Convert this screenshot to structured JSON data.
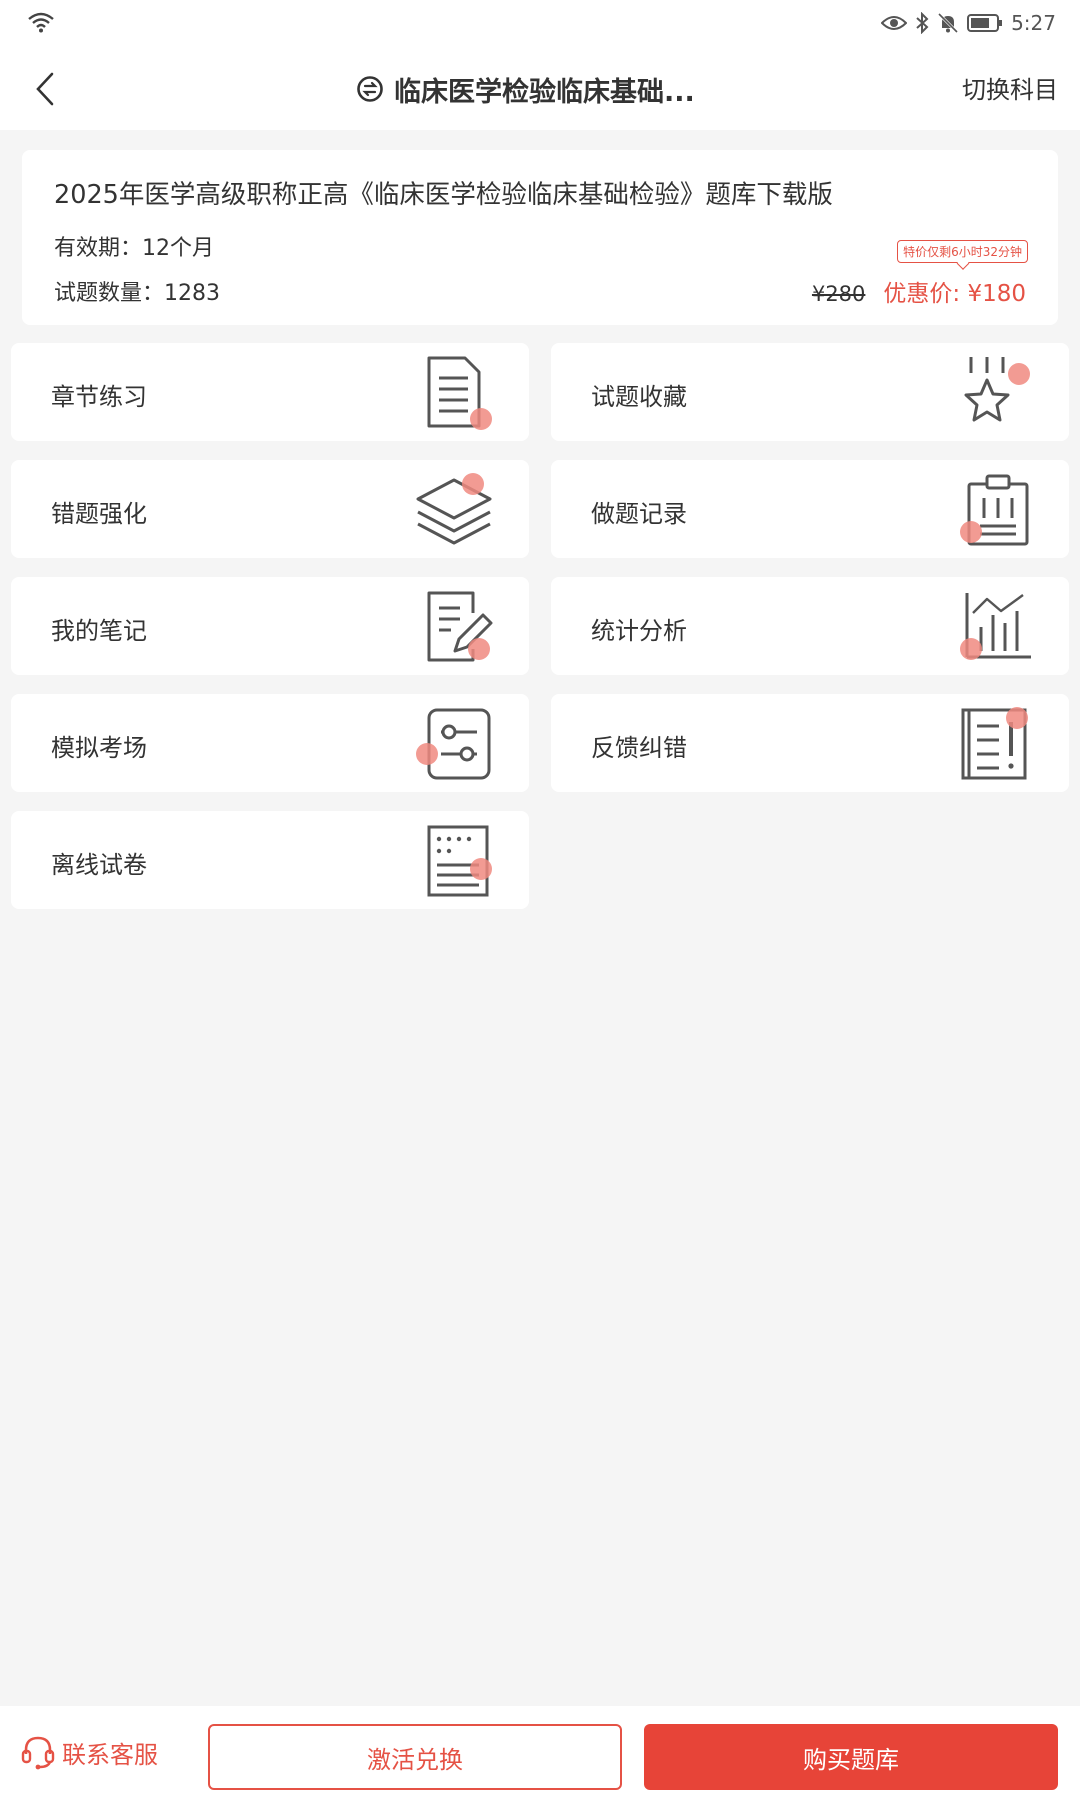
{
  "status_bar": {
    "time": "5:27"
  },
  "header": {
    "title": "临床医学检验临床基础...",
    "switch_label": "切换科目"
  },
  "product": {
    "title": "2025年医学高级职称正高《临床医学检验临床基础检验》题库下载版",
    "validity": "有效期：12个月",
    "count": "试题数量：1283",
    "countdown": "特价仅剩6小时32分钟",
    "original_price": "¥280",
    "sale_price": "优惠价: ¥180"
  },
  "menu": {
    "chapter_practice": "章节练习",
    "favorites": "试题收藏",
    "wrong_review": "错题强化",
    "history": "做题记录",
    "notes": "我的笔记",
    "statistics": "统计分析",
    "mock_exam": "模拟考场",
    "feedback": "反馈纠错",
    "offline_papers": "离线试卷"
  },
  "bottom": {
    "customer_service": "联系客服",
    "activate": "激活兑换",
    "buy": "购买题库"
  },
  "colors": {
    "accent": "#e55245",
    "icon_dot": "#f08a80",
    "icon_stroke": "#555555"
  }
}
